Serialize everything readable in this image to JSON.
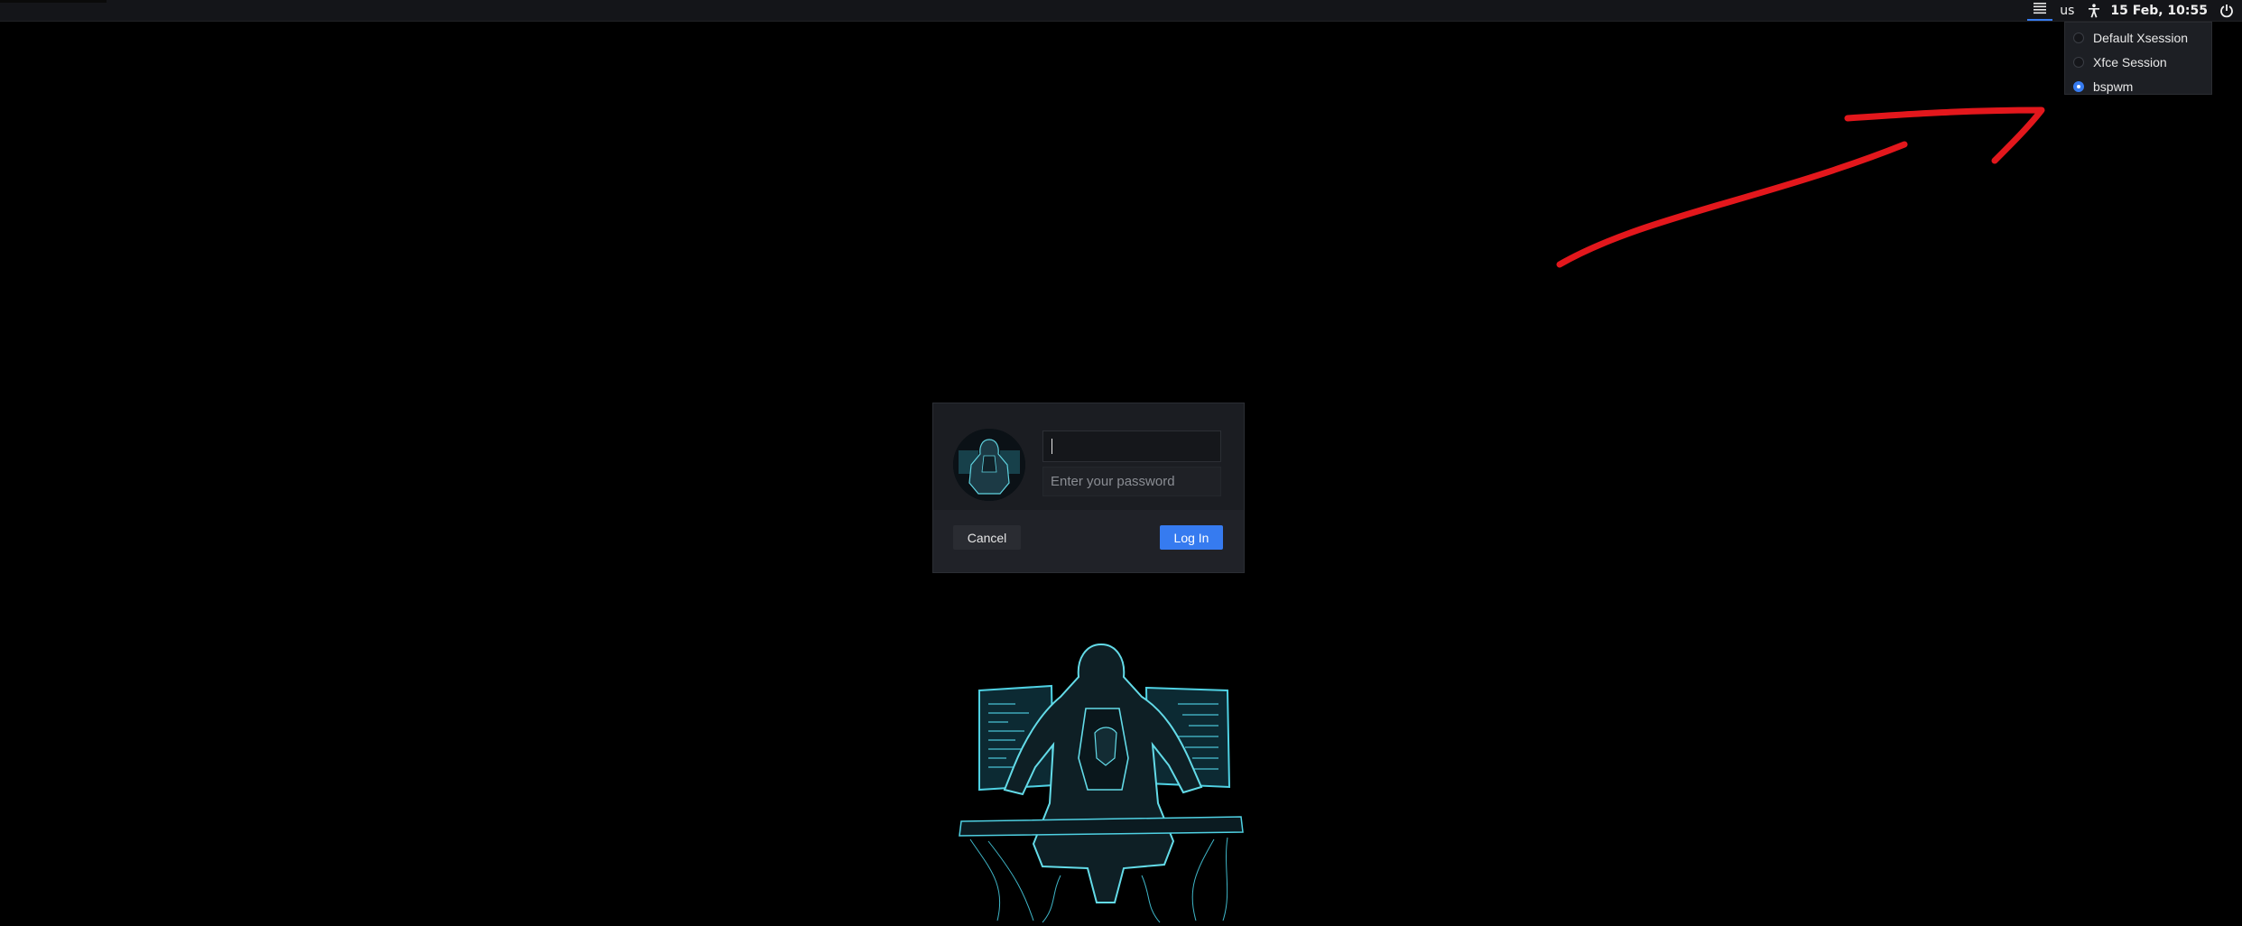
{
  "top_panel": {
    "session_icon": "session-list-icon",
    "keyboard_layout": "us",
    "accessibility_icon": "accessibility-icon",
    "datetime": "15 Feb, 10:55",
    "power_icon": "power-icon"
  },
  "session_menu": {
    "items": [
      {
        "label": "Default Xsession",
        "selected": false
      },
      {
        "label": "Xfce Session",
        "selected": false
      },
      {
        "label": "bspwm",
        "selected": true
      }
    ]
  },
  "login": {
    "username_value": "",
    "password_placeholder": "Enter your password",
    "cancel_label": "Cancel",
    "login_label": "Log In"
  },
  "colors": {
    "accent": "#367bf0",
    "annotation": "#e3171c",
    "background": "#000000"
  }
}
